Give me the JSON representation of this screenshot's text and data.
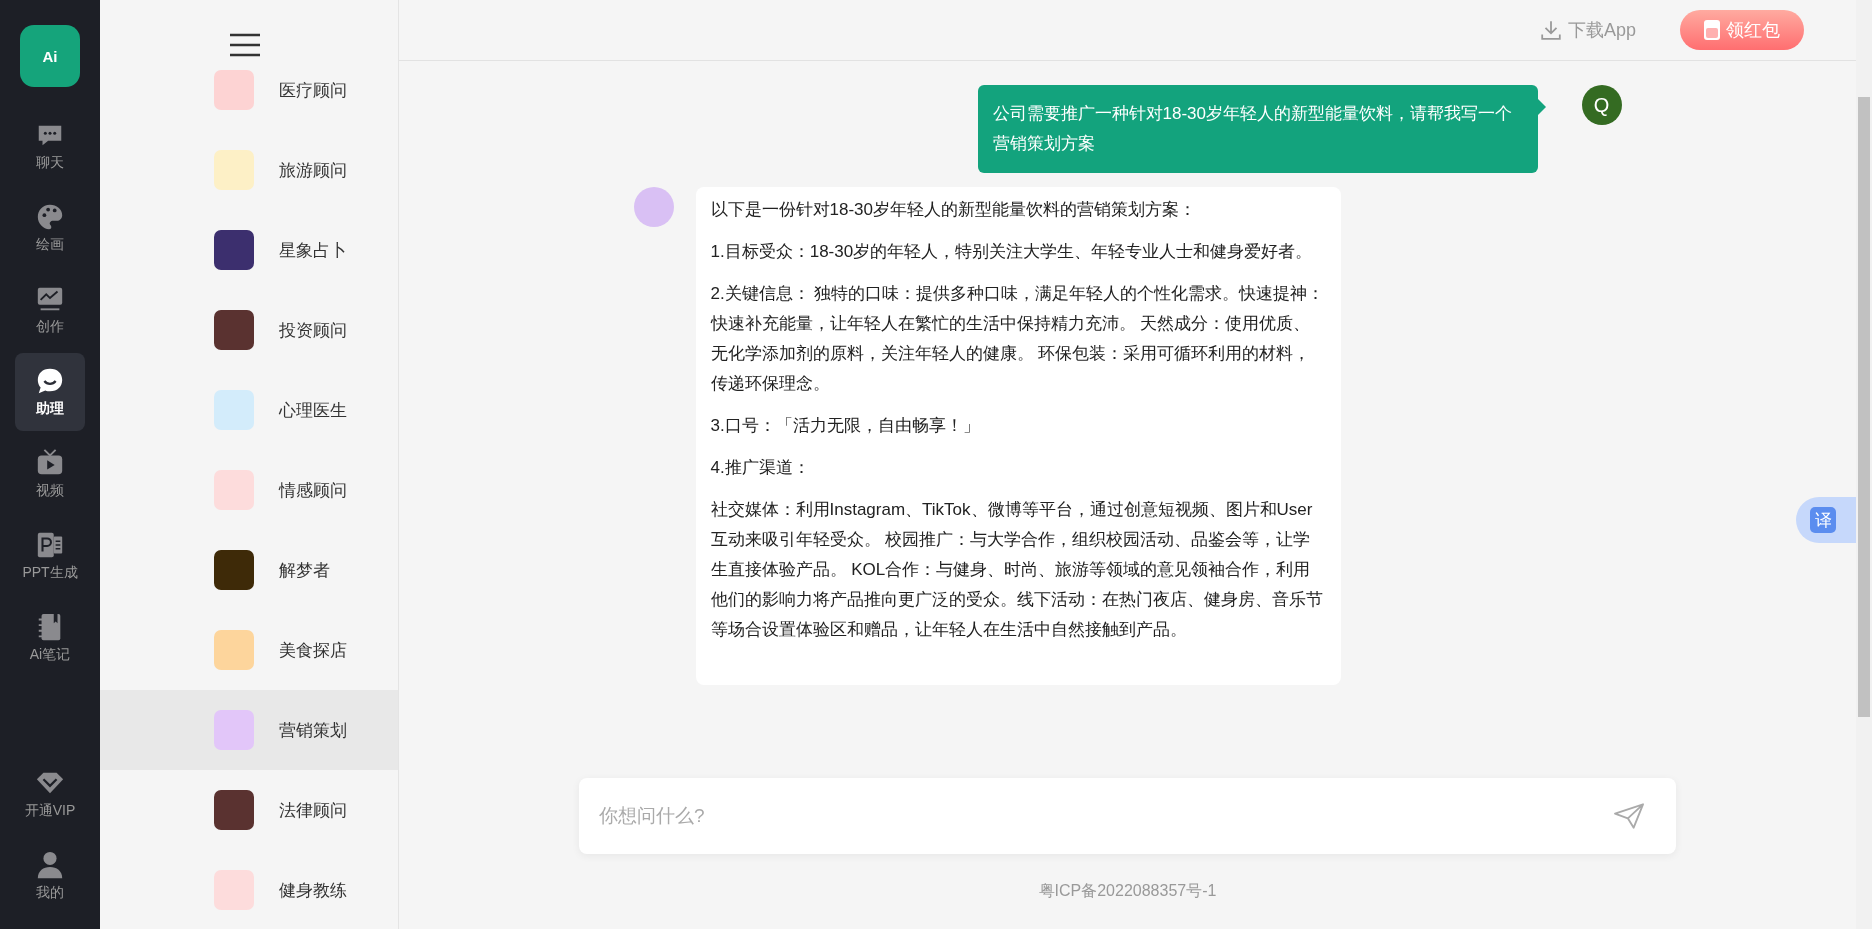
{
  "nav": {
    "logo": "Ai",
    "items": [
      {
        "kind": "chat",
        "label": "聊天",
        "selected": false
      },
      {
        "kind": "paint",
        "label": "绘画",
        "selected": false
      },
      {
        "kind": "create",
        "label": "创作",
        "selected": false
      },
      {
        "kind": "assistant",
        "label": "助理",
        "selected": true
      },
      {
        "kind": "video",
        "label": "视频",
        "selected": false
      },
      {
        "kind": "ppt",
        "label": "PPT生成",
        "selected": false
      },
      {
        "kind": "notes",
        "label": "Ai笔记",
        "selected": false
      }
    ],
    "bottom_items": [
      {
        "kind": "vip",
        "label": "开通VIP"
      },
      {
        "kind": "user",
        "label": "我的"
      }
    ]
  },
  "assistants": [
    {
      "name": "医疗顾问",
      "color": "#fdd3d3",
      "selected": false
    },
    {
      "name": "旅游顾问",
      "color": "#fdf0c6",
      "selected": false
    },
    {
      "name": "星象占卜",
      "color": "#3c2f6e",
      "selected": false
    },
    {
      "name": "投资顾问",
      "color": "#5a3230",
      "selected": false
    },
    {
      "name": "心理医生",
      "color": "#d3ecfb",
      "selected": false
    },
    {
      "name": "情感顾问",
      "color": "#fddcdc",
      "selected": false
    },
    {
      "name": "解梦者",
      "color": "#3e2a08",
      "selected": false
    },
    {
      "name": "美食探店",
      "color": "#fdd59c",
      "selected": false
    },
    {
      "name": "营销策划",
      "color": "#e2c6f9",
      "selected": true
    },
    {
      "name": "法律顾问",
      "color": "#5a3230",
      "selected": false
    },
    {
      "name": "健身教练",
      "color": "#fddcdc",
      "selected": false
    }
  ],
  "top_bar": {
    "download": "下载App",
    "red_packet": "领红包"
  },
  "messages": [
    {
      "kind": "user",
      "avatar": "Q",
      "paragraphs": [
        "公司需要推广一种针对18-30岁年轻人的新型能量饮料，请帮我写一个营销策划方案"
      ]
    },
    {
      "kind": "assistant",
      "paragraphs": [
        "以下是一份针对18-30岁年轻人的新型能量饮料的营销策划方案：",
        "1.目标受众：18-30岁的年轻人，特别关注大学生、年轻专业人士和健身爱好者。",
        "2.关键信息： 独特的口味：提供多种口味，满足年轻人的个性化需求。快速提神：快速补充能量，让年轻人在繁忙的生活中保持精力充沛。 天然成分：使用优质、无化学添加剂的原料，关注年轻人的健康。 环保包装：采用可循环利用的材料，传递环保理念。",
        "3.口号：「活力无限，自由畅享！」",
        "4.推广渠道：",
        "社交媒体：利用Instagram、TikTok、微博等平台，通过创意短视频、图片和User互动来吸引年轻受众。 校园推广：与大学合作，组织校园活动、品鉴会等，让学生直接体验产品。 KOL合作：与健身、时尚、旅游等领域的意见领袖合作，利用他们的影响力将产品推向更广泛的受众。线下活动：在热门夜店、健身房、音乐节等场合设置体验区和赠品，让年轻人在生活中自然接触到产品。"
      ]
    }
  ],
  "input": {
    "placeholder": "你想问什么?"
  },
  "translate": "译",
  "footer": "粤ICP备2022088357号-1"
}
